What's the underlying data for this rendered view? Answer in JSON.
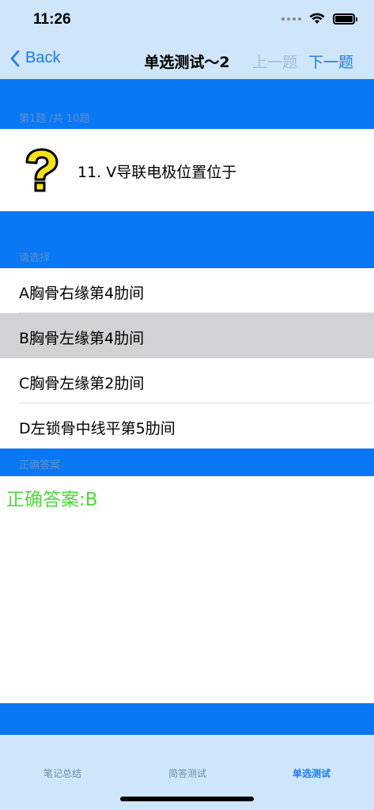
{
  "status": {
    "time": "11:26"
  },
  "nav": {
    "back_label": "Back",
    "title": "单选测试～2",
    "prev_label": "上一题",
    "next_label": "下一题"
  },
  "question": {
    "progress_label": "第1题 /共 10题",
    "text": "11.   V导联电极位置位于"
  },
  "options_header": "请选择",
  "options": [
    {
      "label": "A胸骨右缘第4肋间"
    },
    {
      "label": "B胸骨左缘第4肋间"
    },
    {
      "label": "C胸骨左缘第2肋间"
    },
    {
      "label": "D左锁骨中线平第5肋间"
    }
  ],
  "answer": {
    "header": "正确答案",
    "text": "正确答案:B"
  },
  "tabs": [
    {
      "label": "笔记总结"
    },
    {
      "label": "简答测试"
    },
    {
      "label": "单选测试"
    }
  ],
  "colors": {
    "accent": "#1a7cf0",
    "header_blue": "#0a78f5",
    "nav_background": "#cfe5f9",
    "answer_green": "#4cd93a",
    "selected_row": "#d1d1d6"
  }
}
